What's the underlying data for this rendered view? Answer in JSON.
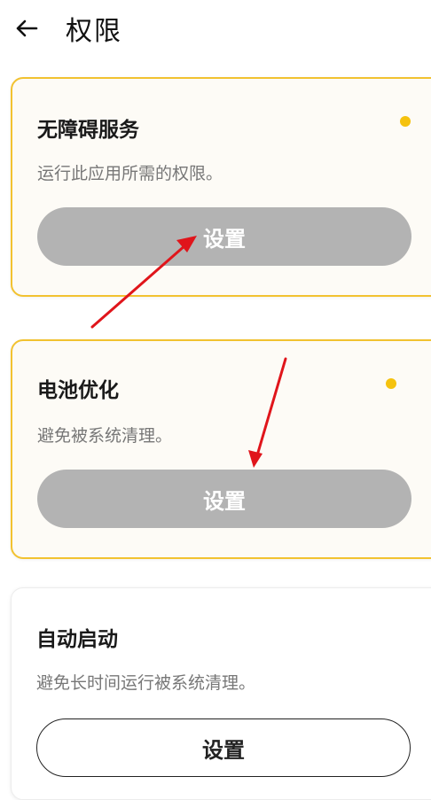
{
  "header": {
    "title": "权限",
    "back_icon": "arrow-left-icon"
  },
  "colors": {
    "warning_border": "#f2c230",
    "status_dot": "#f5c20e",
    "disabled_button": "#b3b3b3",
    "annotation_arrow": "#e0151b"
  },
  "permissions": [
    {
      "title": "无障碍服务",
      "description": "运行此应用所需的权限。",
      "button_label": "设置",
      "status": "required"
    },
    {
      "title": "电池优化",
      "description": "避免被系统清理。",
      "button_label": "设置",
      "status": "required"
    },
    {
      "title": "自动启动",
      "description": "避免长时间运行被系统清理。",
      "button_label": "设置",
      "status": "optional"
    }
  ]
}
